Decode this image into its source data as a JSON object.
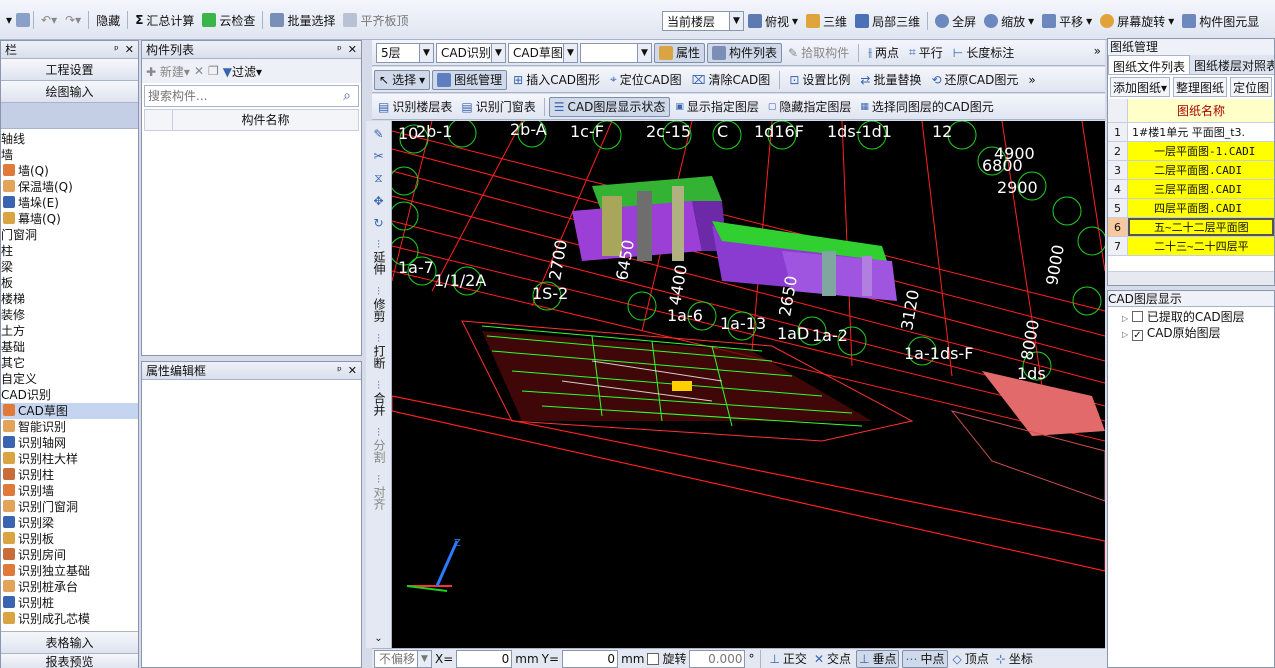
{
  "main_toolbar": {
    "hide": "隐藏",
    "sum_calc": "汇总计算",
    "cloud_check": "云检查",
    "batch_select": "批量选择",
    "flush_slab": "平齐板顶",
    "floor_select": "当前楼层",
    "top_view": "俯视",
    "three_d": "三维",
    "local_3d": "局部三维",
    "fullscreen": "全屏",
    "zoom": "缩放",
    "pan": "平移",
    "screen_rotate": "屏幕旋转",
    "component_display": "构件图元显"
  },
  "left_nav": {
    "title": "栏",
    "project_settings": "工程设置",
    "draw_input": "绘图输入",
    "items": [
      "轴线",
      "墙",
      "墙(Q)",
      "保温墙(Q)",
      "墙垛(E)",
      "幕墙(Q)",
      "门窗洞",
      "柱",
      "梁",
      "板",
      "楼梯",
      "装修",
      "土方",
      "基础",
      "其它",
      "自定义",
      "CAD识别",
      "CAD草图",
      "智能识别",
      "识别轴网",
      "识别柱大样",
      "识别柱",
      "识别墙",
      "识别门窗洞",
      "识别梁",
      "识别板",
      "识别房间",
      "识别独立基础",
      "识别桩承台",
      "识别桩",
      "识别成孔芯模"
    ],
    "table_input": "表格输入",
    "report_preview": "报表预览"
  },
  "component_list": {
    "title": "构件列表",
    "new": "新建",
    "filter": "过滤",
    "search_placeholder": "搜索构件...",
    "column": "构件名称"
  },
  "property_panel": {
    "title": "属性编辑框"
  },
  "cad_toolbar1": {
    "floor": "5层",
    "cad_identify": "CAD识别",
    "cad_sketch": "CAD草图",
    "properties": "属性",
    "component_list": "构件列表",
    "pick_component": "拾取构件",
    "two_points": "两点",
    "parallel": "平行",
    "length_mark": "长度标注"
  },
  "cad_toolbar2": {
    "select": "选择",
    "drawing_manage": "图纸管理",
    "insert_cad": "插入CAD图形",
    "locate_cad": "定位CAD图",
    "clear_cad": "清除CAD图",
    "set_scale": "设置比例",
    "batch_replace": "批量替换",
    "restore_cad": "还原CAD图元"
  },
  "cad_toolbar3": {
    "identify_floor_table": "识别楼层表",
    "identify_door_table": "识别门窗表",
    "cad_layer_status": "CAD图层显示状态",
    "show_layer": "显示指定图层",
    "hide_layer": "隐藏指定图层",
    "select_same_layer": "选择同图层的CAD图元"
  },
  "vertical_tools": [
    "延伸",
    "修剪",
    "打断",
    "合并",
    "分割",
    "对齐"
  ],
  "canvas_labels": [
    "10",
    "2b-1",
    "2b-A",
    "1c-F",
    "2c-15",
    "C",
    "1d16F",
    "1ds-1d1",
    "12",
    "1S-2",
    "1a-6",
    "1a-13",
    "1aD",
    "1a-2",
    "1a-1ds-F",
    "1ds",
    "2700",
    "6450",
    "4400",
    "2650",
    "3120",
    "1/1/2A",
    "1a-7",
    "4900",
    "6800",
    "2900",
    "9000",
    "8000"
  ],
  "drawing_manager": {
    "title": "图纸管理",
    "tab_files": "图纸文件列表",
    "tab_floors": "图纸楼层对照表",
    "add_drawing": "添加图纸",
    "organize": "整理图纸",
    "locate": "定位图",
    "column": "图纸名称",
    "rows": [
      {
        "num": "1",
        "name": "1#楼1单元 平面图_t3."
      },
      {
        "num": "2",
        "name": "一层平面图-1.CADI"
      },
      {
        "num": "3",
        "name": "二层平面图.CADI"
      },
      {
        "num": "4",
        "name": "三层平面图.CADI"
      },
      {
        "num": "5",
        "name": "四层平面图.CADI"
      },
      {
        "num": "6",
        "name": "五~二十二层平面图"
      },
      {
        "num": "7",
        "name": "二十三~二十四层平"
      }
    ]
  },
  "cad_layers": {
    "title": "CAD图层显示",
    "extracted": "已提取的CAD图层",
    "original": "CAD原始图层"
  },
  "status_bar": {
    "no_offset": "不偏移",
    "x_label": "X=",
    "x_value": "0",
    "y_label": "Y=",
    "y_value": "0",
    "unit": "mm",
    "rotate": "旋转",
    "rotate_value": "0.000",
    "degree": "°",
    "ortho": "正交",
    "intersection": "交点",
    "perpendicular": "垂点",
    "midpoint": "中点",
    "vertex": "顶点",
    "coordinate": "坐标"
  }
}
